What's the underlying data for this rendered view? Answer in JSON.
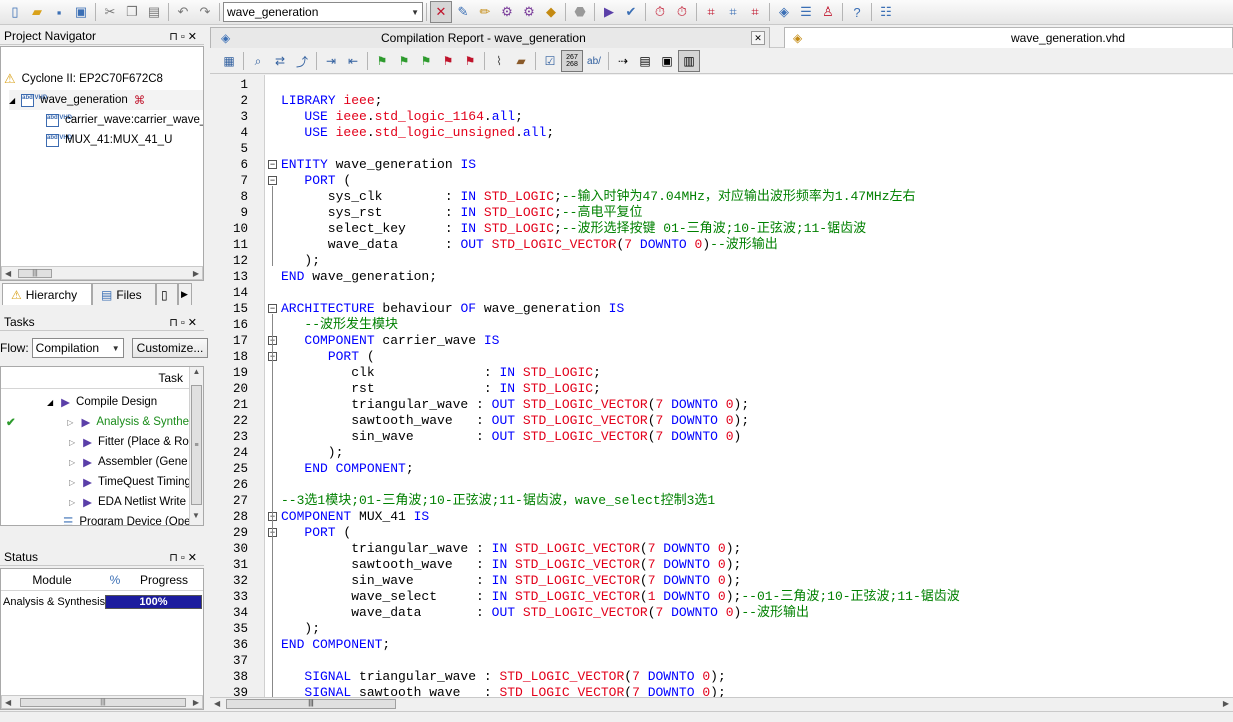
{
  "toolbar": {
    "entity_combo": "wave_generation"
  },
  "project_navigator": {
    "title": "Project Navigator",
    "device": "Cyclone II: EP2C70F672C8",
    "top_entity": "wave_generation",
    "children": [
      "carrier_wave:carrier_wave_",
      "MUX_41:MUX_41_U"
    ],
    "tabs": {
      "hierarchy": "Hierarchy",
      "files": "Files"
    }
  },
  "tasks": {
    "title": "Tasks",
    "flow_label": "Flow:",
    "flow_value": "Compilation",
    "customize_label": "Customize...",
    "column_task": "Task",
    "items": [
      {
        "label": "Compile Design",
        "status": ""
      },
      {
        "label": "Analysis & Synthe",
        "status": "done"
      },
      {
        "label": "Fitter (Place & Ro",
        "status": ""
      },
      {
        "label": "Assembler (Gene",
        "status": ""
      },
      {
        "label": "TimeQuest Timing",
        "status": ""
      },
      {
        "label": "EDA Netlist Write",
        "status": ""
      },
      {
        "label": "Program Device (Ope",
        "status": ""
      }
    ]
  },
  "status_panel": {
    "title": "Status",
    "col_module": "Module",
    "col_percent": "%",
    "col_progress": "Progress",
    "row_module": "Analysis & Synthesis",
    "row_progress_text": "100%",
    "row_progress": 1.0
  },
  "doc_tabs": {
    "report": "Compilation Report - wave_generation",
    "file": "wave_generation.vhd"
  },
  "colors": {
    "keyword": "#0000ff",
    "type": "#e2001a",
    "comment": "#008000",
    "progress": "#1c1c9e"
  },
  "code": [
    [],
    [
      [
        "kw",
        "LIBRARY "
      ],
      [
        "ty",
        "ieee"
      ],
      [
        "pl",
        ";"
      ]
    ],
    [
      [
        "pl",
        "   "
      ],
      [
        "kw",
        "USE "
      ],
      [
        "ty",
        "ieee"
      ],
      [
        "pl",
        "."
      ],
      [
        "ty",
        "std_logic_1164"
      ],
      [
        "pl",
        "."
      ],
      [
        "kw",
        "all"
      ],
      [
        "pl",
        ";"
      ]
    ],
    [
      [
        "pl",
        "   "
      ],
      [
        "kw",
        "USE "
      ],
      [
        "ty",
        "ieee"
      ],
      [
        "pl",
        "."
      ],
      [
        "ty",
        "std_logic_unsigned"
      ],
      [
        "pl",
        "."
      ],
      [
        "kw",
        "all"
      ],
      [
        "pl",
        ";"
      ]
    ],
    [],
    [
      [
        "kw",
        "ENTITY "
      ],
      [
        "pl",
        "wave_generation "
      ],
      [
        "kw",
        "IS"
      ]
    ],
    [
      [
        "pl",
        "   "
      ],
      [
        "kw",
        "PORT "
      ],
      [
        "pl",
        "("
      ]
    ],
    [
      [
        "pl",
        "      sys_clk        : "
      ],
      [
        "kw",
        "IN "
      ],
      [
        "ty",
        "STD_LOGIC"
      ],
      [
        "pl",
        ";"
      ],
      [
        "cm",
        "--输入时钟为47.04MHz，对应输出波形频率为1.47MHz左右"
      ]
    ],
    [
      [
        "pl",
        "      sys_rst        : "
      ],
      [
        "kw",
        "IN "
      ],
      [
        "ty",
        "STD_LOGIC"
      ],
      [
        "pl",
        ";"
      ],
      [
        "cm",
        "--高电平复位"
      ]
    ],
    [
      [
        "pl",
        "      select_key     : "
      ],
      [
        "kw",
        "IN "
      ],
      [
        "ty",
        "STD_LOGIC"
      ],
      [
        "pl",
        ";"
      ],
      [
        "cm",
        "--波形选择按键 01-三角波;10-正弦波;11-锯齿波"
      ]
    ],
    [
      [
        "pl",
        "      wave_data      : "
      ],
      [
        "kw",
        "OUT "
      ],
      [
        "ty",
        "STD_LOGIC_VECTOR"
      ],
      [
        "pl",
        "("
      ],
      [
        "nm",
        "7"
      ],
      [
        "kw",
        " DOWNTO "
      ],
      [
        "nm",
        "0"
      ],
      [
        "pl",
        ")"
      ],
      [
        "cm",
        "--波形输出"
      ]
    ],
    [
      [
        "pl",
        "   );"
      ]
    ],
    [
      [
        "kw",
        "END "
      ],
      [
        "pl",
        "wave_generation;"
      ]
    ],
    [],
    [
      [
        "kw",
        "ARCHITECTURE "
      ],
      [
        "pl",
        "behaviour "
      ],
      [
        "kw",
        "OF "
      ],
      [
        "pl",
        "wave_generation "
      ],
      [
        "kw",
        "IS"
      ]
    ],
    [
      [
        "pl",
        "   "
      ],
      [
        "cm",
        "--波形发生模块"
      ]
    ],
    [
      [
        "pl",
        "   "
      ],
      [
        "kw",
        "COMPONENT "
      ],
      [
        "pl",
        "carrier_wave "
      ],
      [
        "kw",
        "IS"
      ]
    ],
    [
      [
        "pl",
        "      "
      ],
      [
        "kw",
        "PORT "
      ],
      [
        "pl",
        "("
      ]
    ],
    [
      [
        "pl",
        "         clk              : "
      ],
      [
        "kw",
        "IN "
      ],
      [
        "ty",
        "STD_LOGIC"
      ],
      [
        "pl",
        ";"
      ]
    ],
    [
      [
        "pl",
        "         rst              : "
      ],
      [
        "kw",
        "IN "
      ],
      [
        "ty",
        "STD_LOGIC"
      ],
      [
        "pl",
        ";"
      ]
    ],
    [
      [
        "pl",
        "         triangular_wave : "
      ],
      [
        "kw",
        "OUT "
      ],
      [
        "ty",
        "STD_LOGIC_VECTOR"
      ],
      [
        "pl",
        "("
      ],
      [
        "nm",
        "7"
      ],
      [
        "kw",
        " DOWNTO "
      ],
      [
        "nm",
        "0"
      ],
      [
        "pl",
        ");"
      ]
    ],
    [
      [
        "pl",
        "         sawtooth_wave   : "
      ],
      [
        "kw",
        "OUT "
      ],
      [
        "ty",
        "STD_LOGIC_VECTOR"
      ],
      [
        "pl",
        "("
      ],
      [
        "nm",
        "7"
      ],
      [
        "kw",
        " DOWNTO "
      ],
      [
        "nm",
        "0"
      ],
      [
        "pl",
        ");"
      ]
    ],
    [
      [
        "pl",
        "         sin_wave        : "
      ],
      [
        "kw",
        "OUT "
      ],
      [
        "ty",
        "STD_LOGIC_VECTOR"
      ],
      [
        "pl",
        "("
      ],
      [
        "nm",
        "7"
      ],
      [
        "kw",
        " DOWNTO "
      ],
      [
        "nm",
        "0"
      ],
      [
        "pl",
        ")"
      ]
    ],
    [
      [
        "pl",
        "      );"
      ]
    ],
    [
      [
        "pl",
        "   "
      ],
      [
        "kw",
        "END COMPONENT"
      ],
      [
        "pl",
        ";"
      ]
    ],
    [],
    [
      [
        "cm",
        "--3选1模块;01-三角波;10-正弦波;11-锯齿波，wave_select控制3选1"
      ]
    ],
    [
      [
        "kw",
        "COMPONENT "
      ],
      [
        "pl",
        "MUX_41 "
      ],
      [
        "kw",
        "IS"
      ]
    ],
    [
      [
        "pl",
        "   "
      ],
      [
        "kw",
        "PORT "
      ],
      [
        "pl",
        "("
      ]
    ],
    [
      [
        "pl",
        "         triangular_wave : "
      ],
      [
        "kw",
        "IN "
      ],
      [
        "ty",
        "STD_LOGIC_VECTOR"
      ],
      [
        "pl",
        "("
      ],
      [
        "nm",
        "7"
      ],
      [
        "kw",
        " DOWNTO "
      ],
      [
        "nm",
        "0"
      ],
      [
        "pl",
        ");"
      ]
    ],
    [
      [
        "pl",
        "         sawtooth_wave   : "
      ],
      [
        "kw",
        "IN "
      ],
      [
        "ty",
        "STD_LOGIC_VECTOR"
      ],
      [
        "pl",
        "("
      ],
      [
        "nm",
        "7"
      ],
      [
        "kw",
        " DOWNTO "
      ],
      [
        "nm",
        "0"
      ],
      [
        "pl",
        ");"
      ]
    ],
    [
      [
        "pl",
        "         sin_wave        : "
      ],
      [
        "kw",
        "IN "
      ],
      [
        "ty",
        "STD_LOGIC_VECTOR"
      ],
      [
        "pl",
        "("
      ],
      [
        "nm",
        "7"
      ],
      [
        "kw",
        " DOWNTO "
      ],
      [
        "nm",
        "0"
      ],
      [
        "pl",
        ");"
      ]
    ],
    [
      [
        "pl",
        "         wave_select     : "
      ],
      [
        "kw",
        "IN "
      ],
      [
        "ty",
        "STD_LOGIC_VECTOR"
      ],
      [
        "pl",
        "("
      ],
      [
        "nm",
        "1"
      ],
      [
        "kw",
        " DOWNTO "
      ],
      [
        "nm",
        "0"
      ],
      [
        "pl",
        ");"
      ],
      [
        "cm",
        "--01-三角波;10-正弦波;11-锯齿波"
      ]
    ],
    [
      [
        "pl",
        "         wave_data       : "
      ],
      [
        "kw",
        "OUT "
      ],
      [
        "ty",
        "STD_LOGIC_VECTOR"
      ],
      [
        "pl",
        "("
      ],
      [
        "nm",
        "7"
      ],
      [
        "kw",
        " DOWNTO "
      ],
      [
        "nm",
        "0"
      ],
      [
        "pl",
        ")"
      ],
      [
        "cm",
        "--波形输出"
      ]
    ],
    [
      [
        "pl",
        "   );"
      ]
    ],
    [
      [
        "kw",
        "END COMPONENT"
      ],
      [
        "pl",
        ";"
      ]
    ],
    [],
    [
      [
        "pl",
        "   "
      ],
      [
        "kw",
        "SIGNAL "
      ],
      [
        "pl",
        "triangular_wave : "
      ],
      [
        "ty",
        "STD_LOGIC_VECTOR"
      ],
      [
        "pl",
        "("
      ],
      [
        "nm",
        "7"
      ],
      [
        "kw",
        " DOWNTO "
      ],
      [
        "nm",
        "0"
      ],
      [
        "pl",
        ");"
      ]
    ],
    [
      [
        "pl",
        "   "
      ],
      [
        "kw",
        "SIGNAL "
      ],
      [
        "pl",
        "sawtooth_wave   : "
      ],
      [
        "ty",
        "STD_LOGIC_VECTOR"
      ],
      [
        "pl",
        "("
      ],
      [
        "nm",
        "7"
      ],
      [
        "kw",
        " DOWNTO "
      ],
      [
        "nm",
        "0"
      ],
      [
        "pl",
        ");"
      ]
    ]
  ],
  "fold_lines": [
    6,
    7,
    15,
    17,
    18,
    28,
    29
  ]
}
